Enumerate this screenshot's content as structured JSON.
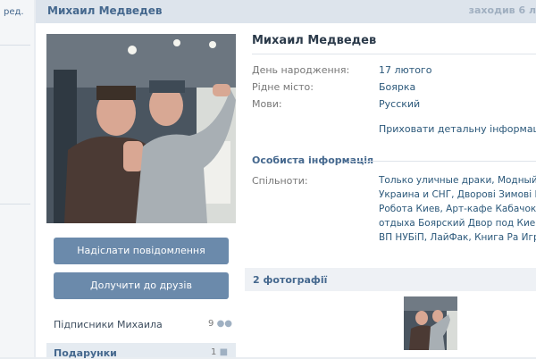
{
  "nav": {
    "edit_label": "ред."
  },
  "header": {
    "name": "Михаил Медведев",
    "status": "заходив 6 л"
  },
  "profile": {
    "avatar_icon": "profile-photo",
    "buttons": {
      "message": "Надіслати повідомлення",
      "add_friend": "Долучити до друзів"
    },
    "subscribers": {
      "label": "Підписники Михаила",
      "count": "9"
    },
    "gifts": {
      "label": "Подарунки",
      "count": "1"
    }
  },
  "info": {
    "name": "Михаил Медведев",
    "fields": [
      {
        "label": "День народження:",
        "value": "17 лютого"
      },
      {
        "label": "Рідне місто:",
        "value": "Боярка"
      },
      {
        "label": "Мови:",
        "value": "Русский"
      }
    ],
    "hide_link": "Приховати детальну інформацію",
    "section_title": "Особиста інформація",
    "communities_label": "Спільноти:",
    "communities_lines": [
      "Только уличные драки, Модный П",
      "Украина и СНГ, Дворові Зимові Іг",
      "Робота Киев, Арт-кафе Кабачок,",
      "отдыха Боярский Двор под Киево",
      "ВП НУБіП, ЛайФак, Книга Ра Игро"
    ]
  },
  "photos": {
    "title": "2 фотографії"
  },
  "colors": {
    "accent": "#45688e",
    "button": "#6b8aab",
    "header_bg": "#dde4ec"
  }
}
